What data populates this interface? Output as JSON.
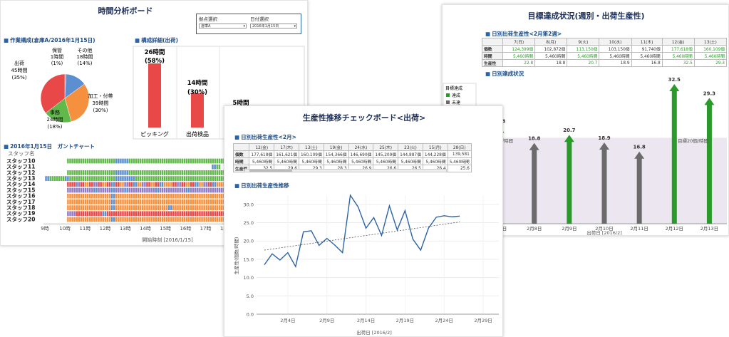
{
  "left_panel": {
    "title": "時間分析ボード",
    "site_select": {
      "label": "拠点選択",
      "value": "倉庫A"
    },
    "date_select": {
      "label": "日付選択",
      "value": "2016年1月15日"
    },
    "pie_section": "作業構成(倉庫A/2016年1月15日)",
    "pie_labels": {
      "hokan": [
        "保管",
        "1時間",
        "(1%)"
      ],
      "sonota": [
        "その他",
        "18時間",
        "(14%)"
      ],
      "shukka": [
        "出荷",
        "45時間",
        "(35%)"
      ],
      "kakou": [
        "加工・付帯",
        "39時間",
        "(30%)"
      ],
      "jimu": [
        "事務",
        "24時間",
        "(18%)"
      ]
    },
    "bar_section": "構成詳細(出荷)",
    "bar_labels": [
      "26時間",
      "(58%)",
      "14時間",
      "(30%)",
      "5時間"
    ],
    "bar_categories": [
      "ピッキング",
      "出荷検品"
    ],
    "gantt_section": "2016年1月15日　ガントチャート",
    "gantt_header": "スタッフ名",
    "gantt_staff": [
      "スタッフ10",
      "スタッフ11",
      "スタッフ12",
      "スタッフ13",
      "スタッフ14",
      "スタッフ15",
      "スタッフ16",
      "スタッフ17",
      "スタッフ18",
      "スタッフ19",
      "スタッフ20"
    ],
    "gantt_ticks": [
      "9時",
      "10時",
      "11時",
      "12時",
      "13時",
      "14時",
      "15時",
      "16時",
      "17時",
      "18時"
    ],
    "gantt_xlabel": "開始時刻 [2016/1/15]"
  },
  "middle_panel": {
    "title": "生産性推移チェックボード<出荷>",
    "table_section": "日別出荷生産性<2月>",
    "table_headers": [
      "12(金)",
      "17(木)",
      "13(土)",
      "19(金)",
      "24(水)",
      "25(木)",
      "23(火)",
      "15(月)",
      "28(日)"
    ],
    "table_rows": [
      {
        "label": "個数",
        "values": [
          "177,618個",
          "161,621個",
          "160,109個",
          "154,366個",
          "146,690個",
          "145,209個",
          "144,887個",
          "144,228個",
          "139,581"
        ]
      },
      {
        "label": "時間",
        "values": [
          "5,460時間",
          "5,460時間",
          "5,460時間",
          "5,460時間",
          "5,460時間",
          "5,460時間",
          "5,460時間",
          "5,460時間",
          "5,460時間"
        ]
      },
      {
        "label": "生産性",
        "values": [
          "32.5",
          "29.6",
          "29.3",
          "28.3",
          "26.9",
          "26.6",
          "26.5",
          "26.4",
          "25.6"
        ]
      }
    ],
    "line_section": "日別出荷生産性推移",
    "line_ylabel": "生産性(個数/時間)",
    "line_xlabel": "出荷日 [2016/2]"
  },
  "right_panel": {
    "title": "目標達成状況(週別・出荷生産性)",
    "table_section": "日別出荷生産性<2月第2週>",
    "table_headers": [
      "7(日)",
      "8(月)",
      "9(火)",
      "10(水)",
      "11(木)",
      "12(金)",
      "13(土)"
    ],
    "table_rows": [
      {
        "label": "個数",
        "values": [
          "124,399個",
          "102,872個",
          "113,150個",
          "103,150個",
          "91,740個",
          "177,618個",
          "160,109個"
        ]
      },
      {
        "label": "時間",
        "values": [
          "5,460時間",
          "5,460時間",
          "5,460時間",
          "5,460時間",
          "5,460時間",
          "5,460時間",
          "5,460時間"
        ]
      },
      {
        "label": "生産性",
        "values": [
          "22.8",
          "18.8",
          "20.7",
          "18.9",
          "16.8",
          "32.5",
          "29.3"
        ]
      }
    ],
    "table_achieved": [
      true,
      false,
      true,
      false,
      false,
      true,
      true
    ],
    "bar_section": "日別達成状況",
    "legend_title": "目標達成",
    "legend_items": [
      "達成",
      "未達"
    ],
    "target_label": "目標20個/時間",
    "xlabel": "出荷日 [2016/2]",
    "colors": {
      "achieved": "#2a9a2a",
      "missed": "#6b6b6b",
      "target_band": "#ece6f0"
    }
  },
  "chart_data": [
    {
      "type": "pie",
      "labels": [
        "保管",
        "その他",
        "加工・付帯",
        "事務",
        "出荷"
      ],
      "values": [
        1,
        18,
        39,
        24,
        45
      ],
      "percents": [
        1,
        14,
        30,
        18,
        35
      ],
      "colors": [
        "#6f7fb8",
        "#5b8fd0",
        "#f5913e",
        "#62b94b",
        "#e84848"
      ]
    },
    {
      "type": "bar",
      "categories": [
        "ピッキング",
        "出荷検品",
        ""
      ],
      "values": [
        26,
        14,
        5
      ],
      "colors": [
        "#e84848",
        "#e84848",
        "#e84848"
      ]
    },
    {
      "type": "line",
      "x": [
        "2016-02-01",
        "2016-02-02",
        "2016-02-03",
        "2016-02-04",
        "2016-02-05",
        "2016-02-06",
        "2016-02-07",
        "2016-02-08",
        "2016-02-09",
        "2016-02-10",
        "2016-02-11",
        "2016-02-12",
        "2016-02-13",
        "2016-02-14",
        "2016-02-15",
        "2016-02-16",
        "2016-02-17",
        "2016-02-18",
        "2016-02-19",
        "2016-02-20",
        "2016-02-21",
        "2016-02-22",
        "2016-02-23",
        "2016-02-24",
        "2016-02-25",
        "2016-02-26"
      ],
      "values": [
        13.5,
        16.5,
        14.8,
        16.8,
        13.0,
        22.5,
        22.8,
        18.8,
        20.7,
        18.9,
        16.8,
        32.5,
        29.3,
        23.5,
        26.4,
        21.5,
        29.6,
        23.0,
        28.3,
        20.5,
        17.5,
        23.5,
        26.5,
        26.9,
        26.6,
        26.8
      ],
      "trend": [
        17.5,
        25.2
      ],
      "yticks": [
        "0.0",
        "2.5",
        "5.0",
        "7.5",
        "10.0",
        "12.5",
        "15.0",
        "17.5",
        "20.0",
        "22.5",
        "25.0",
        "27.5",
        "30.0"
      ],
      "ylim": [
        0,
        32.5
      ],
      "xticks": [
        "2月4日",
        "2月9日",
        "2月14日",
        "2月19日",
        "2月24日",
        "2月29日"
      ],
      "color": "#2b63a8"
    },
    {
      "type": "bar",
      "categories": [
        "2月7日",
        "2月8日",
        "2月9日",
        "2月10日",
        "2月11日",
        "2月12日",
        "2月13日"
      ],
      "values": [
        22.8,
        18.8,
        20.7,
        18.9,
        16.8,
        32.5,
        29.3
      ],
      "target": 20,
      "ylim": [
        0,
        34
      ]
    },
    {
      "type": "gantt",
      "colors": {
        "G": "#62b94b",
        "B": "#5b8fd0",
        "P": "#8f7cc4",
        "R": "#e84848",
        "O": "#f5913e"
      },
      "rows": [
        "..........GGGGGGGGGGGGGGGGGGGGGGBBBBBBGGGGGGGGGGGGGGGGGGGGGGGGGGGGGGGGGGGGGGGGGGGGG",
        "..........................................................................BBGG...",
        "..........GGGGGGGGGGGGGGGGGGGGGGBBBBBBGGGGGGGGGGGGGGGGGGGGGGGGGGGGGGGGGGGGGGGGGGGGG",
        "BBGGGGGGGBBGGGGGGGGGGGGGGGGGGGGGBBBBBBBBBGGGGGGGGGGGGGGGGGGGGGGGGGGGGGGGGGGGGGGGGGG",
        "..........RRRRPPRROORRPPRROORRBBRROOPPRRBBOOPPRROORRBBOOOORRPPRROORRBBOOPPRRBBOOOOO",
        "..........PPPPPPPPPPPPBBPPPPPPBBPPPPBBPPPPPPPPPPPPBBPPPPPPPPPPPPBBPPPPPPPPPPPPPPPPP",
        "..........OOOOOOOOOOOOOOOOOOOOBBOOOOOOOOOOOOOOOOOOOOOOOOOOOOOOOOOOOOOOOOOOOOOOOOOOO",
        "..........OOOOOOOOOOOOOOOOOOOOBBOOOOOOOOOOOOOOOOOOOOOOOOOOOOOOOOOOOOOOOOOOOOOOOOOOO",
        "..........OOOOOOOOOOOOOOOOOOOOBBOOOOOOOOOOOOOOOOOOOOOOOOBBOOOOOOOOOOOOOOOOOOOOOOOOO",
        "..........PPPPRRRRRRRRRRRRBBRRRRRRRRRRRRRRRRRRRRRRRRRRRRRRRRRRRRRRRRRRRRRRRRRRRRRRR",
        "..........OOOOOOOOOOOOOOOOOOOOBBOOOOOOOOOOOOOOOOOOOOOOOOOOOOOOOOOOOOOOOOOOOOOOOOOOO"
      ]
    }
  ]
}
